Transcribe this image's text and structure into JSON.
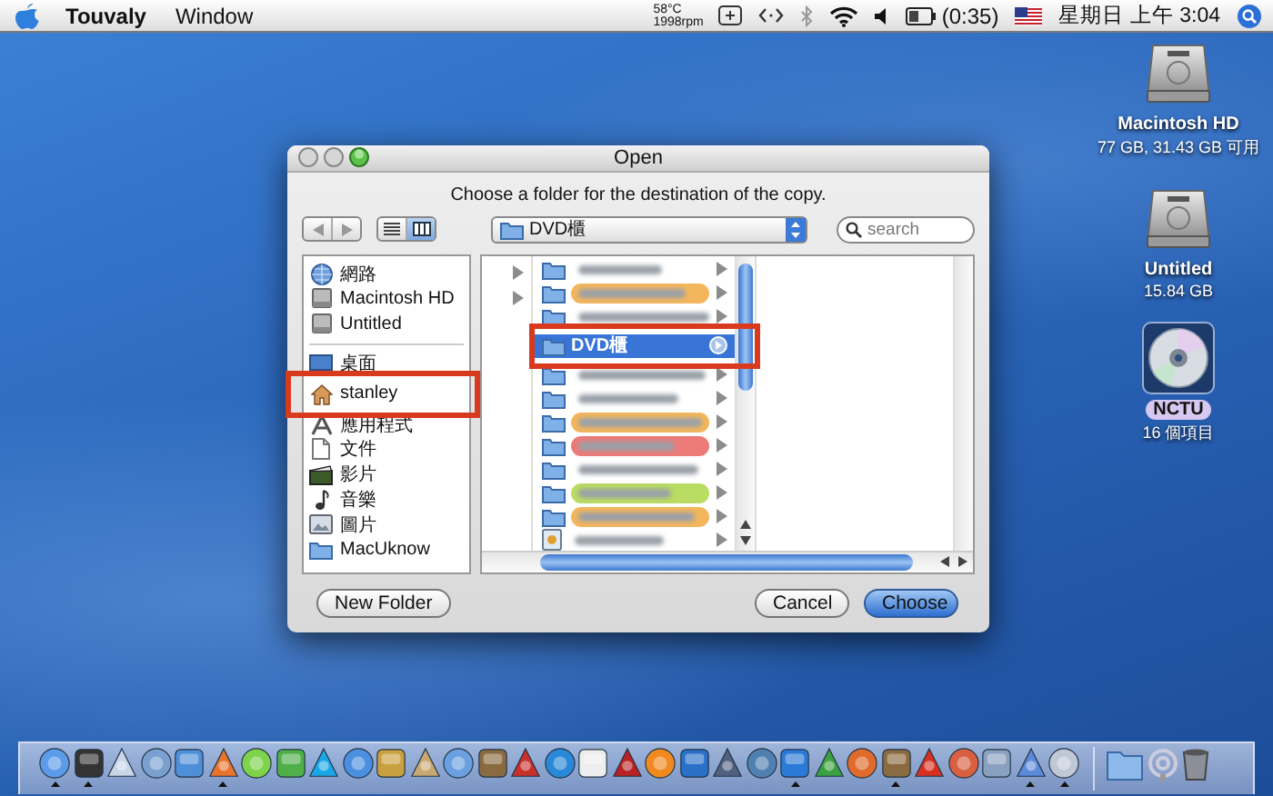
{
  "menu_bar": {
    "app_name": "Touvaly",
    "menus": [
      "Window"
    ],
    "temperature": "58°C",
    "fan_speed": "1998rpm",
    "battery": "(0:35)",
    "clock": "星期日 上午 3:04"
  },
  "desktop_icons": [
    {
      "label": "Macintosh HD",
      "detail": "77 GB, 31.43 GB 可用",
      "kind": "disk",
      "selected": false
    },
    {
      "label": "Untitled",
      "detail": "15.84 GB",
      "kind": "disk",
      "selected": false
    },
    {
      "label": "NCTU",
      "detail": "16 個項目",
      "kind": "disc",
      "selected": true
    }
  ],
  "dialog": {
    "title": "Open",
    "message": "Choose a folder for the destination of the copy.",
    "view_buttons": [
      {
        "kind": "list",
        "selected": false
      },
      {
        "kind": "columns",
        "selected": true
      }
    ],
    "location": "DVD櫃",
    "search": {
      "placeholder": "search"
    },
    "sidebar": {
      "devices": [
        {
          "label": "網路",
          "kind": "network",
          "marked": false
        },
        {
          "label": "Macintosh HD",
          "kind": "disk",
          "marked": false
        },
        {
          "label": "Untitled",
          "kind": "disk",
          "marked": false
        }
      ],
      "places": [
        {
          "label": "桌面",
          "kind": "desktop",
          "marked": false
        },
        {
          "label": "stanley",
          "kind": "home",
          "marked": true
        },
        {
          "label": "應用程式",
          "kind": "applications",
          "marked": false
        },
        {
          "label": "文件",
          "kind": "documents",
          "marked": false
        },
        {
          "label": "影片",
          "kind": "movies",
          "marked": false
        },
        {
          "label": "音樂",
          "kind": "music",
          "marked": false
        },
        {
          "label": "圖片",
          "kind": "pictures",
          "marked": false
        },
        {
          "label": "MacUknow",
          "kind": "folder",
          "marked": false
        }
      ]
    },
    "file_column": [
      {
        "kind": "folder",
        "selected": false,
        "marked": false
      },
      {
        "kind": "folder",
        "color": "#f3b65c",
        "selected": false,
        "marked": false
      },
      {
        "kind": "folder",
        "selected": false,
        "marked": false
      },
      {
        "kind": "folder",
        "label": "DVD櫃",
        "selected": true,
        "marked": true
      },
      {
        "kind": "folder",
        "selected": false,
        "marked": false
      },
      {
        "kind": "folder",
        "selected": false,
        "marked": false
      },
      {
        "kind": "folder",
        "color": "#f3b65c",
        "selected": false,
        "marked": false
      },
      {
        "kind": "folder",
        "color": "#ec7b78",
        "selected": false,
        "marked": false
      },
      {
        "kind": "folder",
        "selected": false,
        "marked": false
      },
      {
        "kind": "folder",
        "color": "#b9dc62",
        "selected": false,
        "marked": false
      },
      {
        "kind": "folder",
        "color": "#f3b65c",
        "selected": false,
        "marked": false
      },
      {
        "kind": "file",
        "selected": false,
        "marked": false
      }
    ],
    "buttons": {
      "new_folder": "New Folder",
      "cancel": "Cancel",
      "choose": "Choose"
    }
  },
  "dock": {
    "apps": [
      {
        "running": true
      },
      {
        "running": true
      },
      {
        "running": false
      },
      {
        "running": false
      },
      {
        "running": false
      },
      {
        "running": true
      },
      {
        "running": false
      },
      {
        "running": false
      },
      {
        "running": false
      },
      {
        "running": false
      },
      {
        "running": false
      },
      {
        "running": false
      },
      {
        "running": false
      },
      {
        "running": false
      },
      {
        "running": false
      },
      {
        "running": false
      },
      {
        "running": false
      },
      {
        "running": false
      },
      {
        "running": false
      },
      {
        "running": false
      },
      {
        "running": false
      },
      {
        "running": false
      },
      {
        "running": true
      },
      {
        "running": false
      },
      {
        "running": false
      },
      {
        "running": true
      },
      {
        "running": false
      },
      {
        "running": false
      },
      {
        "running": false
      },
      {
        "running": true
      },
      {
        "running": true
      }
    ]
  }
}
